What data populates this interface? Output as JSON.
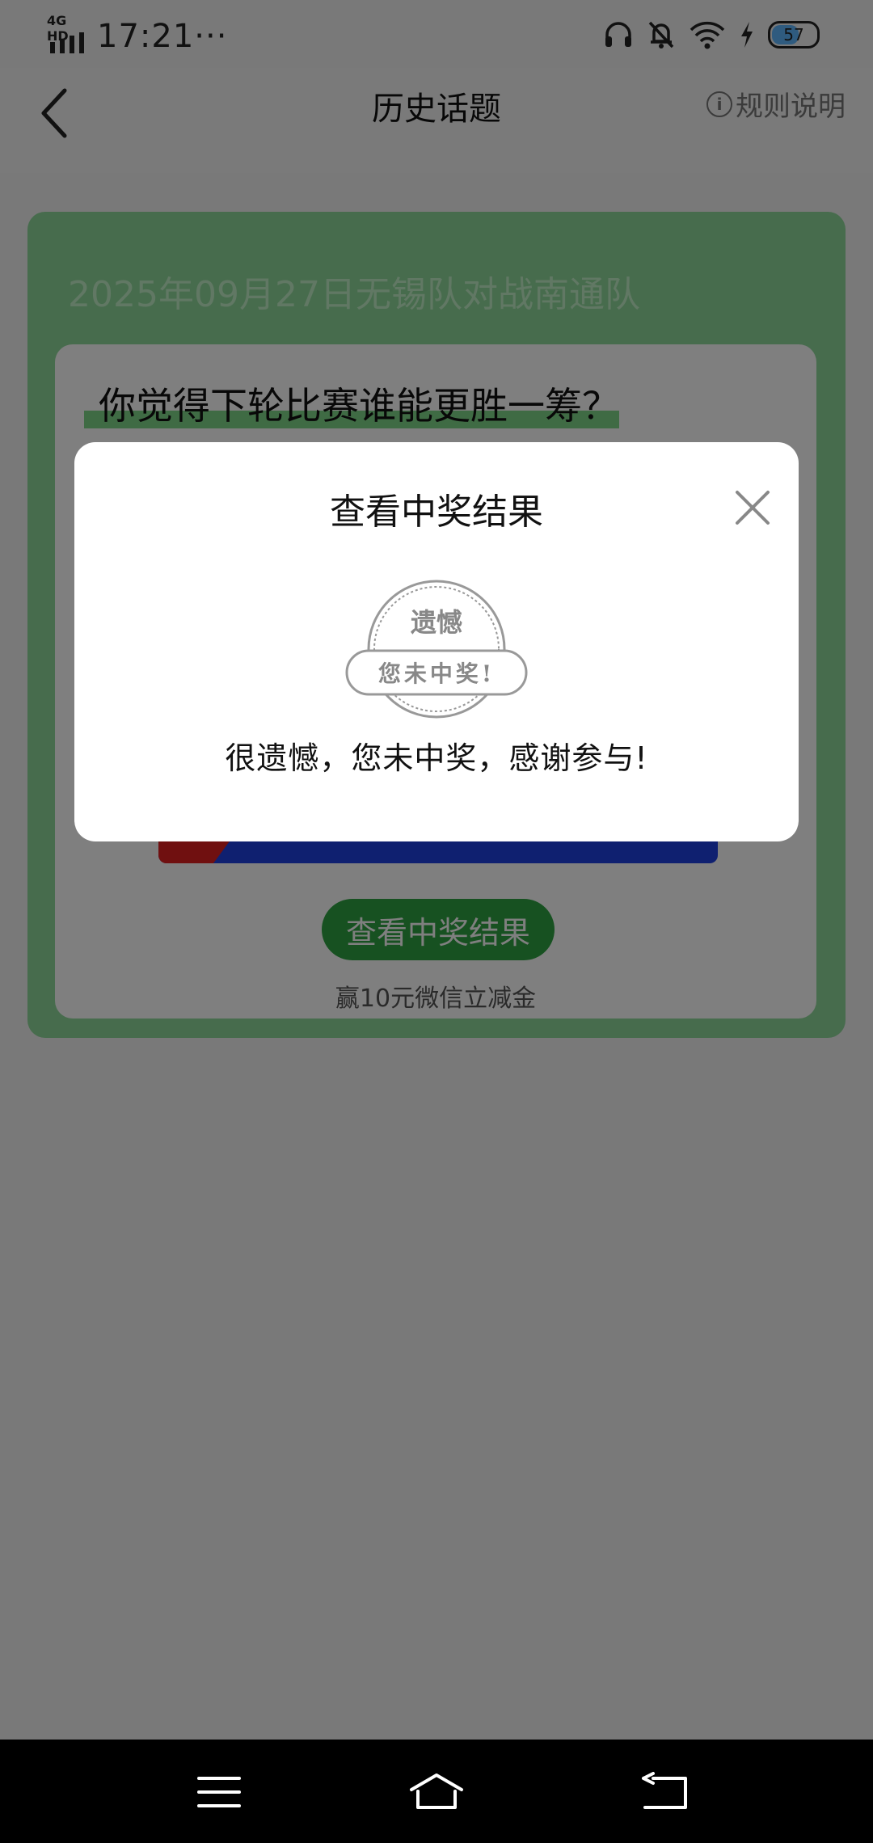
{
  "status_bar": {
    "network": "4G HD",
    "time": "17:21",
    "more_indicator": "···",
    "icons": [
      "headset-icon",
      "mute-icon",
      "wifi-icon",
      "charging-icon"
    ],
    "battery_level": "57",
    "battery_fraction": 0.57
  },
  "nav": {
    "back_icon": "chevron-left-icon",
    "title": "历史话题",
    "rules_icon": "info-icon",
    "rules_label": "规则说明"
  },
  "card": {
    "match_title": "2025年09月27日无锡队对战南通队",
    "question": "你觉得下轮比赛谁能更胜一筹？",
    "vote": {
      "red_fraction": 0.13,
      "colors": {
        "red": "#e02020",
        "blue": "#1e40e0"
      }
    },
    "result_button": "查看中奖结果",
    "reward_text": "赢10元微信立减金"
  },
  "dialog": {
    "title": "查看中奖结果",
    "close_icon": "close-icon",
    "stamp": {
      "top_text": "遗憾",
      "banner_text": "您未中奖!"
    },
    "message": "很遗憾，您未中奖，感谢参与!"
  },
  "system_nav": {
    "icons": [
      "menu-icon",
      "home-icon",
      "back-icon"
    ]
  },
  "colors": {
    "accent_green": "#2ea343",
    "card_green": "#8fd89b",
    "highlight_green": "#7fd688"
  }
}
